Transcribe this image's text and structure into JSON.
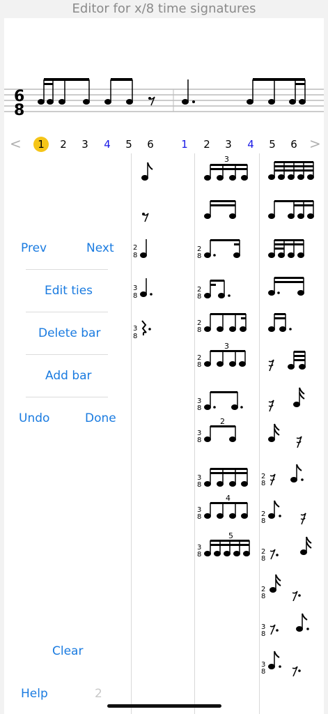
{
  "title": "Editor for x/8 time signatures",
  "staff": {
    "time_signature_top": "6",
    "time_signature_bottom": "8",
    "tuplet_numbers": []
  },
  "beat_counts": {
    "prev_arrow": "<",
    "next_arrow": ">",
    "bar1": [
      "1",
      "2",
      "3",
      "4",
      "5",
      "6"
    ],
    "bar2": [
      "1",
      "2",
      "3",
      "4",
      "5",
      "6"
    ],
    "highlighted": "bar1-1"
  },
  "controls": {
    "prev": "Prev",
    "next": "Next",
    "edit_ties": "Edit ties",
    "delete_bar": "Delete bar",
    "add_bar": "Add bar",
    "undo": "Undo",
    "done": "Done",
    "clear": "Clear",
    "help": "Help",
    "page_number": "2"
  },
  "palette": {
    "col1": [
      "eighth-note",
      "eighth-rest",
      "quarter-note",
      "dotted-quarter-note",
      "dotted-quarter-rest"
    ],
    "col2": [
      "eighth-triplet-16ths",
      "two-16ths",
      "dotted-eighth-16th",
      "16th-dotted-eighth",
      "eighth-eighth-16th",
      "eighth-triplet",
      "dotted-eighth-dotted-eighth",
      "duplet",
      "four-eighths",
      "quadruplet",
      "quintuplet"
    ],
    "col3": [
      "four-16ths",
      "8th-16th-16th",
      "16th-16th-8th",
      "dotted-8th-16th-2",
      "16th-dotted-8th-2",
      "16th-rest-two-16ths",
      "16th-rest-dotted-8th-32nd",
      "16th-16th-rest",
      "16th-rest-dotted-8th",
      "dotted-8th-16th-rest",
      "dotted-16th-rest-16th",
      "16th-dotted-16th-rest",
      "dotted-8th-rest-dotted-8th",
      "dotted-8th-dotted-8th-rest"
    ],
    "tuplet_labels": {
      "triplet": "3",
      "duplet": "2",
      "quadruplet": "4",
      "quintuplet": "5"
    },
    "sig_2_8_top": "2",
    "sig_2_8_bottom": "8",
    "sig_3_8_top": "3",
    "sig_3_8_bottom": "8"
  },
  "colors": {
    "accent": "#1a7be0",
    "highlight": "#f5c518",
    "count_blue": "#1a1ae6"
  }
}
